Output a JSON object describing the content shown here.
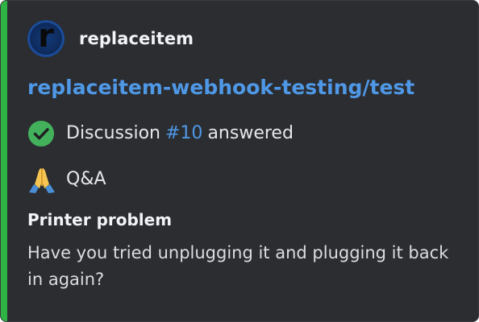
{
  "embed": {
    "accent_color": "#2fb344",
    "background_color": "#2b2d31",
    "author": {
      "avatar_letter": "r",
      "name": "replaceitem"
    },
    "title": "replaceitem-webhook-testing/test",
    "status_line": {
      "icon": "check-circle-icon",
      "prefix": "Discussion",
      "link": "#10",
      "suffix": "answered"
    },
    "category_line": {
      "icon": "folded-hands-icon",
      "label": "Q&A"
    },
    "thread": {
      "title": "Printer problem",
      "body": "Have you tried unplugging it and plugging it back in again?"
    }
  }
}
